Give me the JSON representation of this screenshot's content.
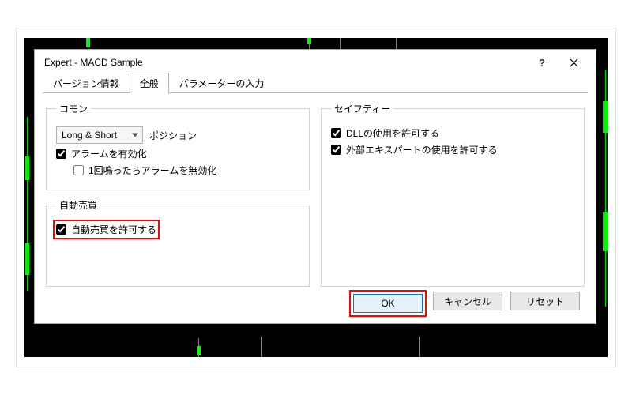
{
  "dialog": {
    "title": "Expert - MACD Sample",
    "help_label": "?",
    "close_label": "×"
  },
  "tabs": {
    "version": "バージョン情報",
    "general": "全般",
    "params": "パラメーターの入力"
  },
  "groups": {
    "common": "コモン",
    "autotrade": "自動売買",
    "safety": "セイフティー"
  },
  "common": {
    "position_select": "Long & Short",
    "position_label": "ポジション",
    "alarm_enable": "アラームを有効化",
    "alarm_disable_after_one": "1回鳴ったらアラームを無効化"
  },
  "autotrade": {
    "allow": "自動売買を許可する"
  },
  "safety": {
    "allow_dll": "DLLの使用を許可する",
    "allow_ext_expert": "外部エキスパートの使用を許可する"
  },
  "buttons": {
    "ok": "OK",
    "cancel": "キャンセル",
    "reset": "リセット"
  },
  "checked": {
    "alarm_enable": true,
    "alarm_disable_after_one": false,
    "autotrade_allow": true,
    "allow_dll": true,
    "allow_ext_expert": true
  }
}
